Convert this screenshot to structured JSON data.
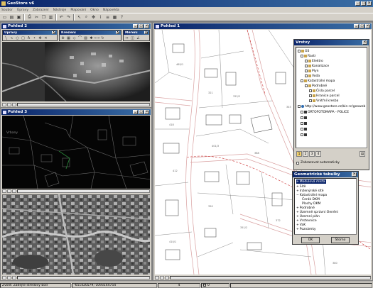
{
  "app": {
    "title": "GeoStore v6",
    "menu": [
      "Soubor",
      "Úpravy",
      "Zobrazení",
      "Nástroje",
      "Mapování",
      "Okno",
      "Nápověda"
    ]
  },
  "views": {
    "view2": {
      "title": "Pohled 2",
      "tool_left_title": "Úpravy",
      "tool_mid_title": "Kreslení",
      "tool_right_title": "Měření"
    },
    "view3": {
      "title": "Pohled 3",
      "overlay_label": "Vrbany"
    },
    "view1": {
      "title": "Pohled 1"
    }
  },
  "layers_panel": {
    "title": "Vrstvy",
    "items": [
      {
        "label": "GS",
        "indent": 0
      },
      {
        "label": "Rastr",
        "indent": 1
      },
      {
        "label": "Elektro",
        "indent": 2
      },
      {
        "label": "Kanalizace",
        "indent": 2
      },
      {
        "label": "Plyn",
        "indent": 2
      },
      {
        "label": "Voda",
        "indent": 2
      },
      {
        "label": "Katastrální mapa",
        "indent": 1
      },
      {
        "label": "Podrobné",
        "indent": 2
      },
      {
        "label": "Čísla parcel",
        "indent": 3
      },
      {
        "label": "Hranice parcel",
        "indent": 3
      },
      {
        "label": "Vnitřní kresba",
        "indent": 3
      },
      {
        "label": "http://www.geostore.cz/bin-rc/geoweb",
        "indent": 0
      },
      {
        "label": "ORTOFOTOMAPA - POLICE",
        "indent": 1
      },
      {
        "label": "",
        "indent": 1
      },
      {
        "label": "",
        "indent": 1
      },
      {
        "label": "",
        "indent": 1
      },
      {
        "label": "",
        "indent": 1
      }
    ],
    "pages": [
      "1",
      "2",
      "3",
      "4"
    ],
    "auto_show_label": "Zobrazovat automaticky"
  },
  "geo_tables": {
    "title": "Geometrické tabulky",
    "items": [
      {
        "label": "Modulová místa",
        "indent": 0,
        "selected": true
      },
      {
        "label": "Sítě"
      },
      {
        "label": "Inženýrské sítě"
      },
      {
        "label": "Katastrální mapa"
      },
      {
        "label": "Čerák DKM",
        "indent": 1
      },
      {
        "label": "Plochy DKM",
        "indent": 1
      },
      {
        "label": "Podrobné"
      },
      {
        "label": "Územně správní členění"
      },
      {
        "label": "Územní plán"
      },
      {
        "label": "Vrstevnice"
      },
      {
        "label": "VaK"
      },
      {
        "label": "Poznámky"
      }
    ],
    "ok_label": "OK",
    "cancel_label": "Storno"
  },
  "statusbar": {
    "hint": "Zvolit: Zadejte středový bod",
    "coords": "-651420579,-1093144754",
    "scale": "4",
    "snap": "0"
  },
  "colors": {
    "title_active": "#0a246a",
    "title_gradient_end": "#3a6ea5",
    "map_background": "#ffffff",
    "road_color": "#e2a8a8",
    "accent_selection": "#0a246a"
  }
}
